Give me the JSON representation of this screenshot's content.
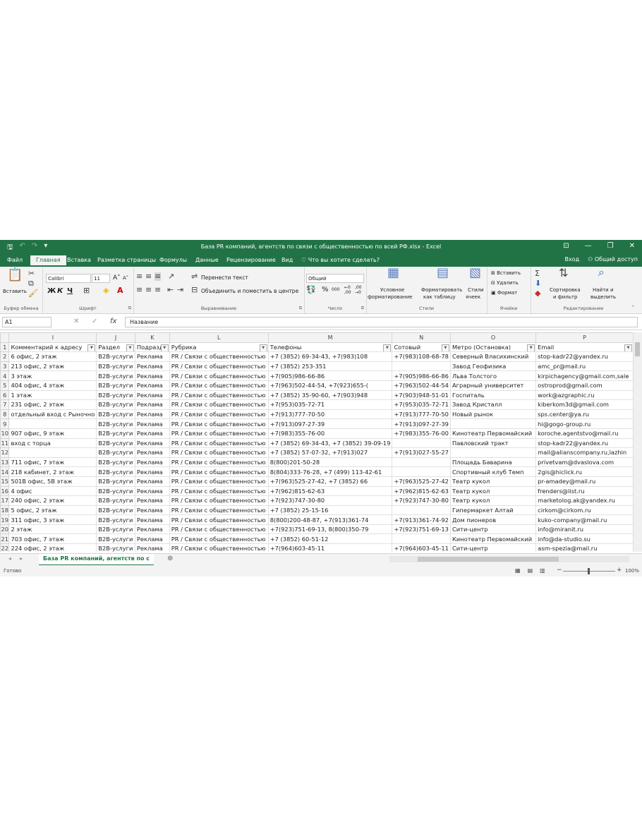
{
  "window": {
    "title": "База PR компаний, агентств по связи с общественностью по всей РФ.xlsx - Excel",
    "controls": [
      "⊡",
      "—",
      "❐",
      "✕"
    ]
  },
  "tabs": [
    "Файл",
    "Главная",
    "Вставка",
    "Разметка страницы",
    "Формулы",
    "Данные",
    "Рецензирование",
    "Вид"
  ],
  "tell_me": "Что вы хотите сделать?",
  "signin": "Вход",
  "share": "Общий доступ",
  "ribbon": {
    "clipboard": {
      "paste": "Вставить",
      "label": "Буфер обмена"
    },
    "font": {
      "name": "Calibri",
      "size": "11",
      "label": "Шрифт",
      "bold": "Ж",
      "italic": "К",
      "underline": "Ч"
    },
    "alignment": {
      "wrap": "Перенести текст",
      "merge": "Объединить и поместить в центре",
      "label": "Выравнивание"
    },
    "number": {
      "format": "Общий",
      "label": "Число"
    },
    "styles": {
      "conditional_1": "Условное",
      "conditional_2": "форматирование",
      "table_1": "Форматировать",
      "table_2": "как таблицу",
      "cell_1": "Стили",
      "cell_2": "ячеек",
      "label": "Стили"
    },
    "cells": {
      "insert": "Вставить",
      "delete": "Удалить",
      "format": "Формат",
      "label": "Ячейки"
    },
    "editing": {
      "sort_1": "Сортировка",
      "sort_2": "и фильтр",
      "find_1": "Найти и",
      "find_2": "выделить",
      "label": "Редактирование"
    }
  },
  "formula_bar": {
    "cell": "A1",
    "formula": "Название"
  },
  "columns": [
    "I",
    "J",
    "K",
    "L",
    "M",
    "N",
    "O",
    "P"
  ],
  "header_row": [
    "Комментарий к адресу",
    "Раздел",
    "Подразде",
    "Рубрика",
    "Телефоны",
    "Сотовый",
    "Метро (Остановка)",
    "Email"
  ],
  "rows": [
    {
      "n": "2",
      "c": [
        "6 офис, 2 этаж",
        "B2B-услуги",
        "Реклама",
        "PR / Связи с общественностью",
        "+7 (3852) 69-34-43, +7(983)108",
        "+7(983)108-68-78",
        "Северный Власихинский",
        "stop-kadr22@yandex.ru"
      ]
    },
    {
      "n": "3",
      "c": [
        "213 офис, 2 этаж",
        "B2B-услуги",
        "Реклама",
        "PR / Связи с общественностью",
        "+7 (3852) 253-351",
        "",
        "Завод Геофизика",
        "amc_pr@mail.ru"
      ]
    },
    {
      "n": "4",
      "c": [
        "3 этаж",
        "B2B-услуги",
        "Реклама",
        "PR / Связи с общественностью",
        "+7(905)986-66-86",
        "+7(905)986-66-86",
        "Льва Толстого",
        "kirpichagency@gmail.com,sale"
      ]
    },
    {
      "n": "5",
      "c": [
        "404 офис, 4 этаж",
        "B2B-услуги",
        "Реклама",
        "PR / Связи с общественностью",
        "+7(963)502-44-54, +7(923)655-(",
        "+7(963)502-44-54",
        "Аграрный университет",
        "ostroprod@gmail.com"
      ]
    },
    {
      "n": "6",
      "c": [
        "1 этаж",
        "B2B-услуги",
        "Реклама",
        "PR / Связи с общественностью",
        "+7 (3852) 35-90-60, +7(903)948",
        "+7(903)948-51-01",
        "Госпиталь",
        "work@azgraphic.ru"
      ]
    },
    {
      "n": "7",
      "c": [
        "231 офис, 2 этаж",
        "B2B-услуги",
        "Реклама",
        "PR / Связи с общественностью",
        "+7(953)035-72-71",
        "+7(953)035-72-71",
        "Завод Кристалл",
        "kiberkom3d@gmail.com"
      ]
    },
    {
      "n": "8",
      "c": [
        "отдельный вход с Рыночно",
        "B2B-услуги",
        "Реклама",
        "PR / Связи с общественностью",
        "+7(913)777-70-50",
        "+7(913)777-70-50",
        "Новый рынок",
        "sps.center@ya.ru"
      ]
    },
    {
      "n": "9",
      "c": [
        "",
        "B2B-услуги",
        "Реклама",
        "PR / Связи с общественностью",
        "+7(913)097-27-39",
        "+7(913)097-27-39",
        "",
        "hi@gogo-group.ru"
      ]
    },
    {
      "n": "10",
      "c": [
        "907 офис, 9 этаж",
        "B2B-услуги",
        "Реклама",
        "PR / Связи с общественностью",
        "+7(983)355-76-00",
        "+7(983)355-76-00",
        "Кинотеатр Первомайский",
        "koroche.agentstvo@mail.ru"
      ]
    },
    {
      "n": "11",
      "c": [
        "вход с торца",
        "B2B-услуги",
        "Реклама",
        "PR / Связи с общественностью",
        "+7 (3852) 69-34-43, +7 (3852) 39-09-19",
        "",
        "Павловский тракт",
        "stop-kadr22@yandex.ru"
      ]
    },
    {
      "n": "12",
      "c": [
        "",
        "B2B-услуги",
        "Реклама",
        "PR / Связи с общественностью",
        "+7 (3852) 57-07-32, +7(913)027",
        "+7(913)027-55-27",
        "",
        "mail@alianscompany.ru,lazhin"
      ]
    },
    {
      "n": "13",
      "c": [
        "711 офис, 7 этаж",
        "B2B-услуги",
        "Реклама",
        "PR / Связи с общественностью",
        "8(800)201-50-28",
        "",
        "Площадь Баварина",
        "privetvam@dvaslova.com"
      ]
    },
    {
      "n": "14",
      "c": [
        "218 кабинет, 2 этаж",
        "B2B-услуги",
        "Реклама",
        "PR / Связи с общественностью",
        "8(804)333-76-28, +7 (499) 113-42-61",
        "",
        "Спортивный клуб Темп",
        "2gis@hiclick.ru"
      ]
    },
    {
      "n": "15",
      "c": [
        "501В офис, 5В этаж",
        "B2B-услуги",
        "Реклама",
        "PR / Связи с общественностью",
        "+7(963)525-27-42, +7 (3852) 66",
        "+7(963)525-27-42",
        "Театр кукол",
        "pr-amadey@mail.ru"
      ]
    },
    {
      "n": "16",
      "c": [
        "4 офис",
        "B2B-услуги",
        "Реклама",
        "PR / Связи с общественностью",
        "+7(962)815-62-63",
        "+7(962)815-62-63",
        "Театр кукол",
        "frenders@list.ru"
      ]
    },
    {
      "n": "17",
      "c": [
        "240 офис, 2 этаж",
        "B2B-услуги",
        "Реклама",
        "PR / Связи с общественностью",
        "+7(923)747-30-80",
        "+7(923)747-30-80",
        "Театр кукол",
        "marketolog.ak@yandex.ru"
      ]
    },
    {
      "n": "18",
      "c": [
        "5 офис, 2 этаж",
        "B2B-услуги",
        "Реклама",
        "PR / Связи с общественностью",
        "+7 (3852) 25-15-16",
        "",
        "Гипермаркет Алтай",
        "cirkom@cirkom.ru"
      ]
    },
    {
      "n": "19",
      "c": [
        "311 офис, 3 этаж",
        "B2B-услуги",
        "Реклама",
        "PR / Связи с общественностью",
        "8(800)200-48-87, +7(913)361-74",
        "+7(913)361-74-92",
        "Дом пионеров",
        "kuko-company@mail.ru"
      ]
    },
    {
      "n": "20",
      "c": [
        "2 этаж",
        "B2B-услуги",
        "Реклама",
        "PR / Связи с общественностью",
        "+7(923)751-69-13, 8(800)350-79",
        "+7(923)751-69-13",
        "Сити-центр",
        "info@miranit.ru"
      ]
    },
    {
      "n": "21",
      "c": [
        "703 офис, 7 этаж",
        "B2B-услуги",
        "Реклама",
        "PR / Связи с общественностью",
        "+7 (3852) 60-51-12",
        "",
        "Кинотеатр Первомайский",
        "info@da-studio.su"
      ]
    },
    {
      "n": "22",
      "c": [
        "224 офис, 2 этаж",
        "B2B-услуги",
        "Реклама",
        "PR / Связи с общественностью",
        "+7(964)603-45-11",
        "+7(964)603-45-11",
        "Сити-центр",
        "asm-spezia@mail.ru"
      ]
    }
  ],
  "sheet_tab": "База PR компаний, агентств по с",
  "status": {
    "ready": "Готово",
    "zoom": "100%"
  },
  "colors": {
    "accent": "#217346"
  }
}
